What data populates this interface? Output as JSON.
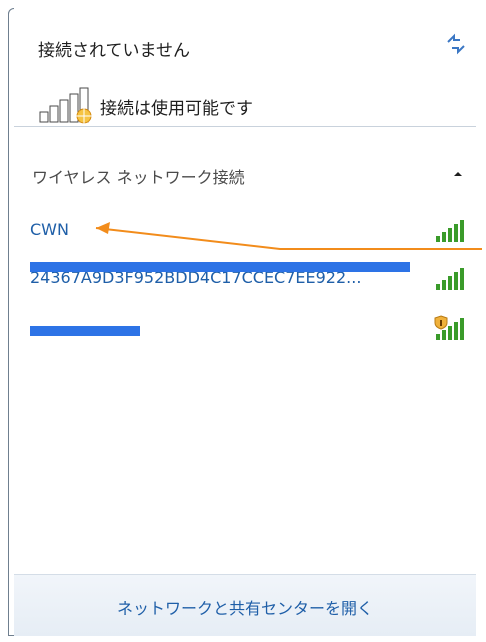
{
  "header": {
    "status_title": "接続されていません",
    "connection_status": "接続は使用可能です",
    "icons": {
      "refresh": "refresh-arrows-icon",
      "available": "network-available-icon"
    }
  },
  "section": {
    "title": "ワイヤレス ネットワーク接続",
    "collapse_icon": "chevron-up-icon"
  },
  "networks": [
    {
      "name": "CWN",
      "signal_icon": "wifi-signal-icon",
      "secured": false
    },
    {
      "name": "24367A9D3F952BDD4C17CCEC7EE922...",
      "signal_icon": "wifi-signal-icon",
      "secured": false
    },
    {
      "name": "",
      "signal_icon": "wifi-signal-secured-icon",
      "secured": true
    }
  ],
  "footer": {
    "link": "ネットワークと共有センターを開く"
  },
  "colors": {
    "link_blue": "#1f5fa8",
    "signal_green": "#3a9b2a",
    "annotation_orange": "#f28c1b",
    "redaction_blue": "#2d73e6"
  }
}
